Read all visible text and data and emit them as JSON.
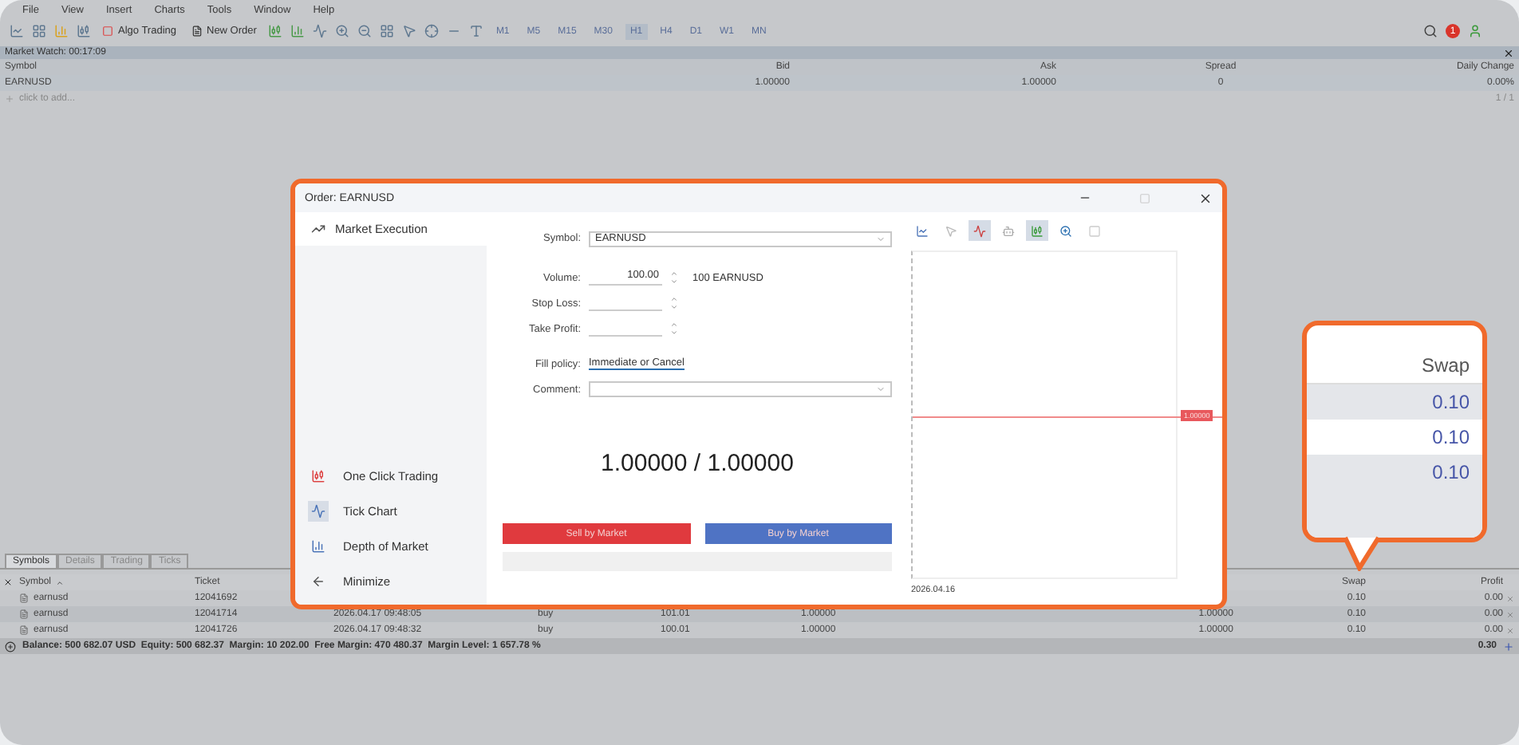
{
  "menu": [
    "File",
    "View",
    "Insert",
    "Charts",
    "Tools",
    "Window",
    "Help"
  ],
  "toolbar": {
    "buttons": [
      "Algo Trading",
      "New Order"
    ],
    "timeframes": [
      {
        "label": "M1",
        "selected": false
      },
      {
        "label": "M5",
        "selected": false
      },
      {
        "label": "M15",
        "selected": false
      },
      {
        "label": "M30",
        "selected": false
      },
      {
        "label": "H1",
        "selected": true
      },
      {
        "label": "H4",
        "selected": false
      },
      {
        "label": "D1",
        "selected": false
      },
      {
        "label": "W1",
        "selected": false
      },
      {
        "label": "MN",
        "selected": false
      }
    ],
    "notification_count": "1"
  },
  "market_watch": {
    "title": "Market Watch: 00:17:09",
    "columns": [
      "Symbol",
      "Bid",
      "Ask",
      "Spread",
      "Daily Change"
    ],
    "rows": [
      {
        "symbol": "EARNUSD",
        "bid": "1.00000",
        "ask": "1.00000",
        "spread": "0",
        "daily_change": "0.00%"
      }
    ],
    "add_hint": "click to add...",
    "page": "1 / 1"
  },
  "terminal": {
    "tabs": [
      {
        "label": "Symbols",
        "selected": true
      },
      {
        "label": "Details",
        "selected": false
      },
      {
        "label": "Trading",
        "selected": false
      },
      {
        "label": "Ticks",
        "selected": false
      }
    ],
    "columns": {
      "symbol": "Symbol",
      "ticket": "Ticket",
      "swap": "Swap",
      "profit": "Profit"
    },
    "rows": [
      {
        "symbol": "earnusd",
        "ticket": "12041692",
        "swap": "0.10",
        "profit": "0.00"
      },
      {
        "symbol": "earnusd",
        "ticket": "12041714",
        "time": "2026.04.17 09:48:05",
        "type": "buy",
        "volume": "101.01",
        "price": "1.00000",
        "current": "1.00000",
        "swap": "0.10",
        "profit": "0.00"
      },
      {
        "symbol": "earnusd",
        "ticket": "12041726",
        "time": "2026.04.17 09:48:32",
        "type": "buy",
        "volume": "100.01",
        "price": "1.00000",
        "current": "1.00000",
        "swap": "0.10",
        "profit": "0.00"
      }
    ],
    "status": "Balance: 500 682.07 USD  Equity: 500 682.37  Margin: 10 202.00  Free Margin: 470 480.37  Margin Level: 1 657.78 %",
    "total": "0.30"
  },
  "order_dialog": {
    "title": "Order: EARNUSD",
    "order_type": "Market Execution",
    "tools": [
      {
        "label": "One Click Trading",
        "selected": false
      },
      {
        "label": "Tick Chart",
        "selected": true
      },
      {
        "label": "Depth of Market",
        "selected": false
      },
      {
        "label": "Minimize",
        "selected": false
      }
    ],
    "fields": {
      "symbol_label": "Symbol:",
      "symbol": "EARNUSD",
      "volume_label": "Volume:",
      "volume": "100.00",
      "volume_note": "100 EARNUSD",
      "stop_loss_label": "Stop Loss:",
      "take_profit_label": "Take Profit:",
      "fill_policy_label": "Fill policy:",
      "fill_policy": "Immediate or Cancel",
      "comment_label": "Comment:"
    },
    "quote": "1.00000 / 1.00000",
    "sell_button": "Sell by Market",
    "buy_button": "Buy by Market",
    "chart_toolbar": [
      {
        "selected": false
      },
      {
        "selected": false
      },
      {
        "selected": true
      },
      {
        "selected": false
      },
      {
        "selected": true
      },
      {
        "selected": false
      },
      {
        "selected": false
      }
    ],
    "chart_price": "1.00000",
    "chart_date": "2026.04.16"
  },
  "callout": {
    "header": "Swap",
    "values": [
      "0.10",
      "0.10",
      "0.10"
    ]
  }
}
